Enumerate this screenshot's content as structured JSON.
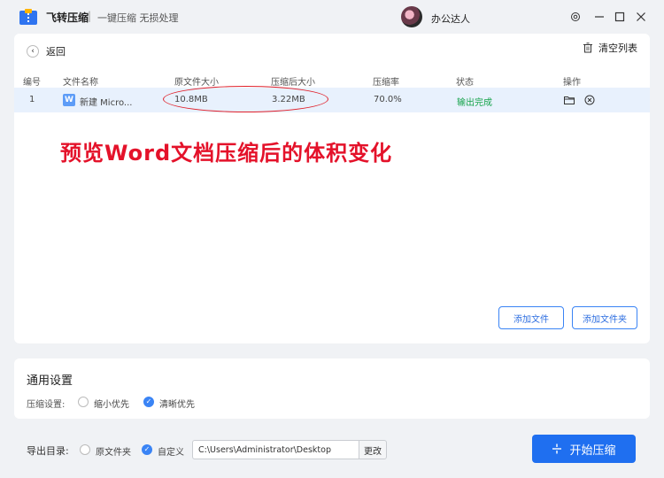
{
  "app": {
    "name": "飞转压缩",
    "separator": "|",
    "slogan": "一键压缩 无损处理",
    "user_name": "办公达人"
  },
  "toolbar": {
    "back_label": "返回",
    "clear_label": "清空列表"
  },
  "table": {
    "headers": [
      "编号",
      "文件名称",
      "原文件大小",
      "压缩后大小",
      "压缩率",
      "状态",
      "操作"
    ],
    "rows": [
      {
        "index": "1",
        "file_icon": "W",
        "file_name": "新建 Micro...",
        "original_size": "10.8MB",
        "compressed_size": "3.22MB",
        "ratio": "70.0%",
        "status": "输出完成"
      }
    ]
  },
  "annotation": {
    "caption": "预览Word文档压缩后的体积变化"
  },
  "buttons": {
    "add_file": "添加文件",
    "add_folder": "添加文件夹",
    "change": "更改",
    "start": "开始压缩"
  },
  "settings": {
    "title": "通用设置",
    "compression_label": "压缩设置:",
    "options": [
      {
        "label": "缩小优先",
        "checked": false
      },
      {
        "label": "清晰优先",
        "checked": true
      }
    ]
  },
  "export": {
    "label": "导出目录:",
    "options": [
      {
        "label": "原文件夹",
        "checked": false
      },
      {
        "label": "自定义",
        "checked": true
      }
    ],
    "path": "C:\\Users\\Administrator\\Desktop"
  },
  "colors": {
    "accent": "#1f6ff0",
    "annotation_red": "#e4122a",
    "success": "#15a34a",
    "row_highlight": "#e8f1fd"
  },
  "icons": [
    "app-logo-icon",
    "back-arrow-icon",
    "trash-icon",
    "word-file-icon",
    "folder-icon",
    "close-circle-icon",
    "settings-icon",
    "minimize-icon",
    "maximize-icon",
    "close-icon",
    "compress-icon"
  ]
}
